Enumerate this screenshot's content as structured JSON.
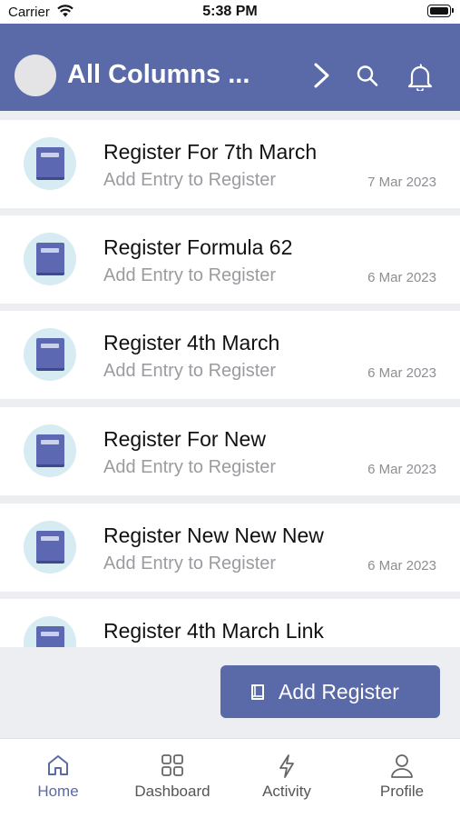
{
  "status_bar": {
    "carrier": "Carrier",
    "time": "5:38 PM"
  },
  "header": {
    "title": "All Columns ..."
  },
  "registers": [
    {
      "title": "Register For 7th March",
      "subtitle": "Add Entry to Register",
      "date": "7 Mar 2023"
    },
    {
      "title": "Register Formula 62",
      "subtitle": "Add Entry to Register",
      "date": "6 Mar 2023"
    },
    {
      "title": "Register 4th March",
      "subtitle": "Add Entry to Register",
      "date": "6 Mar 2023"
    },
    {
      "title": "Register For New",
      "subtitle": "Add Entry to Register",
      "date": "6 Mar 2023"
    },
    {
      "title": "Register New New New",
      "subtitle": "Add Entry to Register",
      "date": "6 Mar 2023"
    },
    {
      "title": "Register 4th March Link",
      "subtitle": "",
      "date": ""
    }
  ],
  "add_button": {
    "label": "Add Register",
    "icon": "book-icon"
  },
  "tabs": [
    {
      "label": "Home",
      "icon": "home-icon",
      "active": true
    },
    {
      "label": "Dashboard",
      "icon": "grid-icon",
      "active": false
    },
    {
      "label": "Activity",
      "icon": "bolt-icon",
      "active": false
    },
    {
      "label": "Profile",
      "icon": "person-icon",
      "active": false
    }
  ],
  "colors": {
    "accent": "#5a6aa8",
    "icon_circle": "#d6ecf2",
    "book": "#5c68b2"
  }
}
